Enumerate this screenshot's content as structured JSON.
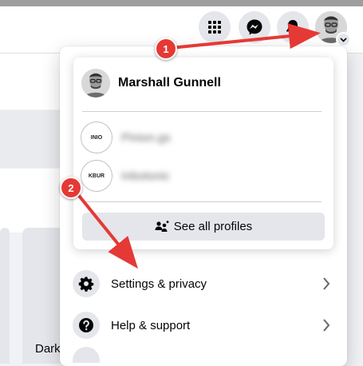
{
  "topbar": {
    "icons": [
      "menu-grid-icon",
      "messenger-icon",
      "notifications-bell-icon",
      "account-avatar"
    ]
  },
  "background": {
    "card_text": "Dark"
  },
  "account_menu": {
    "current_profile": {
      "name": "Marshall Gunnell"
    },
    "other_profiles": [
      {
        "name": "Pinion.gs",
        "avatar_text": "INIO",
        "blurred": true
      },
      {
        "name": "Inbotonic",
        "avatar_text": "KBUR",
        "blurred": true
      }
    ],
    "see_all_profiles": {
      "label": "See all profiles",
      "icon": "profiles-icon"
    },
    "items": [
      {
        "label": "Settings & privacy",
        "icon": "gear-icon"
      },
      {
        "label": "Help & support",
        "icon": "question-icon"
      }
    ]
  },
  "annotations": {
    "step1": "1",
    "step2": "2",
    "color": "#e53935"
  }
}
